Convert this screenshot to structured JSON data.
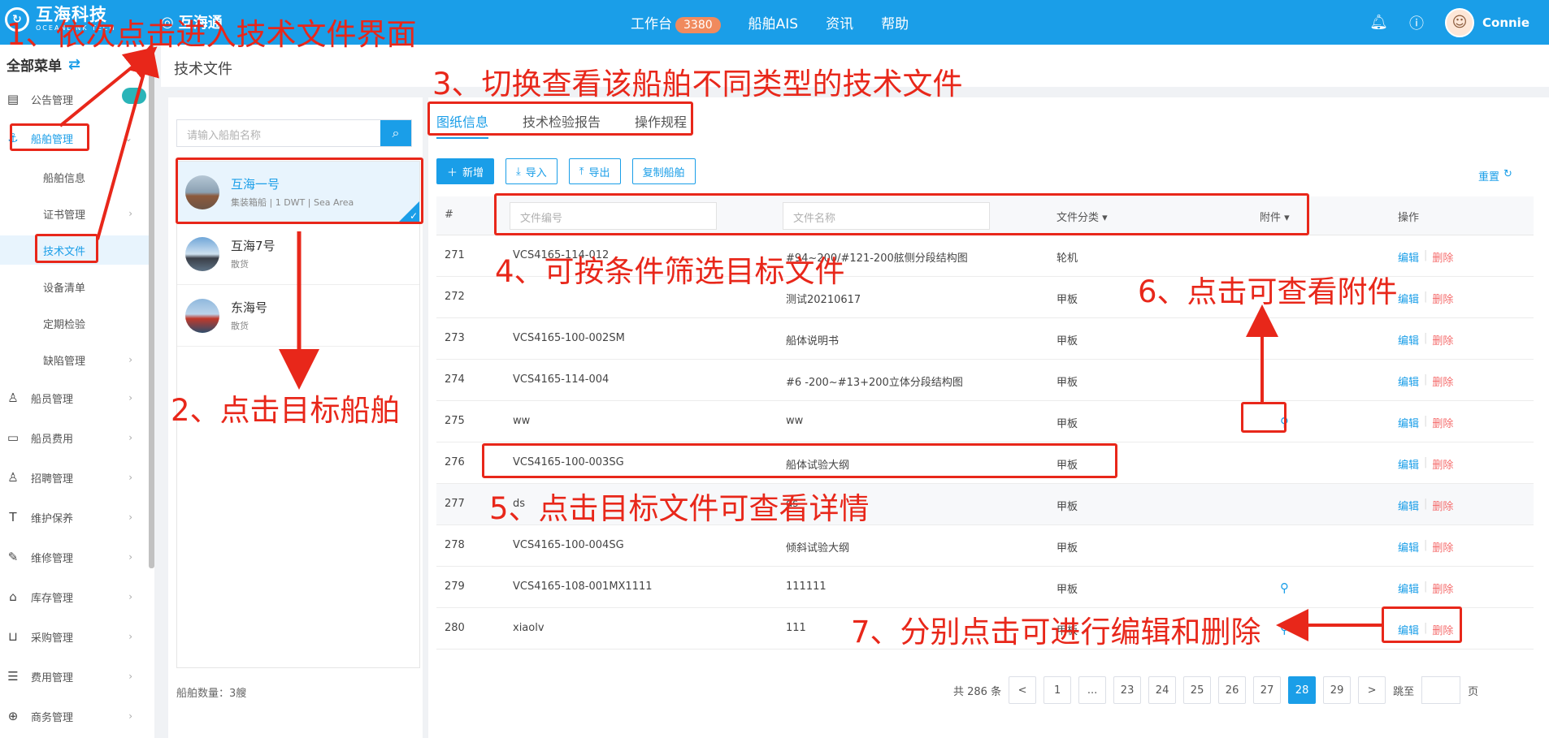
{
  "topbar": {
    "logo_cn": "互海科技",
    "logo_en": "OCEANLINK TECH",
    "system_name": "互海通",
    "nav": [
      {
        "label": "工作台",
        "badge": "3380"
      },
      {
        "label": "船舶AIS"
      },
      {
        "label": "资讯"
      },
      {
        "label": "帮助"
      }
    ],
    "user_name": "Connie"
  },
  "sidebar": {
    "header": "全部菜单",
    "items": [
      {
        "label": "公告管理",
        "icon": "book-icon"
      },
      {
        "label": "船舶管理",
        "icon": "anchor-icon"
      },
      {
        "label": "船舶信息"
      },
      {
        "label": "证书管理"
      },
      {
        "label": "技术文件"
      },
      {
        "label": "设备清单"
      },
      {
        "label": "定期检验"
      },
      {
        "label": "缺陷管理"
      },
      {
        "label": "船员管理",
        "icon": "person-icon"
      },
      {
        "label": "船员费用",
        "icon": "wallet-icon"
      },
      {
        "label": "招聘管理",
        "icon": "person-icon"
      },
      {
        "label": "维护保养",
        "icon": "tool-icon"
      },
      {
        "label": "维修管理",
        "icon": "wrench-icon"
      },
      {
        "label": "库存管理",
        "icon": "home-icon"
      },
      {
        "label": "采购管理",
        "icon": "cart-icon"
      },
      {
        "label": "费用管理",
        "icon": "database-icon"
      },
      {
        "label": "商务管理",
        "icon": "globe-icon"
      }
    ]
  },
  "breadcrumb": "技术文件",
  "ships": {
    "search_placeholder": "请输入船舶名称",
    "list": [
      {
        "name": "互海一号",
        "desc": "集装箱船 | 1 DWT | Sea Area"
      },
      {
        "name": "互海7号",
        "desc": "散货"
      },
      {
        "name": "东海号",
        "desc": "散货"
      }
    ],
    "count_text": "船舶数量：3艘"
  },
  "tabs": [
    "图纸信息",
    "技术检验报告",
    "操作规程"
  ],
  "toolbar": {
    "add": "新增",
    "import": "导入",
    "export": "导出",
    "copy": "复制船舶",
    "reset": "重置"
  },
  "table": {
    "headers": {
      "idx": "#",
      "no_placeholder": "文件编号",
      "name_placeholder": "文件名称",
      "category": "文件分类",
      "attachment": "附件",
      "op": "操作"
    },
    "edit_label": "编辑",
    "delete_label": "删除",
    "rows": [
      {
        "idx": "271",
        "no": "VCS4165-114-012",
        "name": "#94~200/#121-200舷侧分段结构图",
        "cat": "轮机",
        "att": false
      },
      {
        "idx": "272",
        "no": "",
        "name": "测试20210617",
        "cat": "甲板",
        "att": false
      },
      {
        "idx": "273",
        "no": "VCS4165-100-002SM",
        "name": "船体说明书",
        "cat": "甲板",
        "att": false
      },
      {
        "idx": "274",
        "no": "VCS4165-114-004",
        "name": "#6 -200~#13+200立体分段结构图",
        "cat": "甲板",
        "att": false
      },
      {
        "idx": "275",
        "no": "ww",
        "name": "ww",
        "cat": "甲板",
        "att": true
      },
      {
        "idx": "276",
        "no": "VCS4165-100-003SG",
        "name": "船体试验大纲",
        "cat": "甲板",
        "att": false
      },
      {
        "idx": "277",
        "no": "ds",
        "name": "ds",
        "cat": "甲板",
        "att": false
      },
      {
        "idx": "278",
        "no": "VCS4165-100-004SG",
        "name": "倾斜试验大纲",
        "cat": "甲板",
        "att": false
      },
      {
        "idx": "279",
        "no": "VCS4165-108-001MX1111",
        "name": "111111",
        "cat": "甲板",
        "att": true
      },
      {
        "idx": "280",
        "no": "xiaolv",
        "name": "111",
        "cat": "甲板",
        "att": true
      }
    ]
  },
  "pager": {
    "total": "共 286 条",
    "prev": "<",
    "next": ">",
    "pages": [
      "1",
      "...",
      "23",
      "24",
      "25",
      "26",
      "27",
      "28",
      "29"
    ],
    "current": "28",
    "jump_label": "跳至",
    "page_unit": "页"
  },
  "annotations": [
    "1、依次点击进入技术文件界面",
    "2、点击目标船舶",
    "3、切换查看该船舶不同类型的技术文件",
    "4、可按条件筛选目标文件",
    "5、点击目标文件可查看详情",
    "6、点击可查看附件",
    "7、分别点击可进行编辑和删除"
  ],
  "colors": {
    "primary": "#1a9ee8",
    "annotation": "#e8271a",
    "danger": "#f56c6c",
    "badge": "#f08a5d"
  }
}
